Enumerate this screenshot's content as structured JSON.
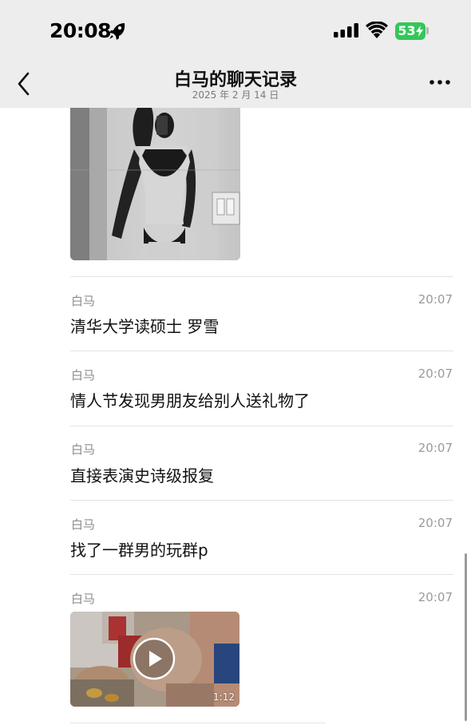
{
  "status_bar": {
    "time": "20:08",
    "battery": "53",
    "icons": [
      "rocket-icon",
      "signal-icon",
      "wifi-icon",
      "battery-icon"
    ],
    "battery_color": "#34c759"
  },
  "header": {
    "title": "白马的聊天记录",
    "subtitle": "2025 年 2 月 14 日",
    "back_icon": "chevron-left-icon",
    "more_icon": "more-dots-icon"
  },
  "messages": [
    {
      "sender": "白马",
      "time": "20:07",
      "text": "清华大学读硕士  罗雪"
    },
    {
      "sender": "白马",
      "time": "20:07",
      "text": "情人节发现男朋友给别人送礼物了"
    },
    {
      "sender": "白马",
      "time": "20:07",
      "text": "直接表演史诗级报复"
    },
    {
      "sender": "白马",
      "time": "20:07",
      "text": "找了一群男的玩群p"
    },
    {
      "sender": "白马",
      "time": "20:07",
      "video": {
        "duration": "1:12"
      }
    }
  ],
  "colors": {
    "header_bg": "#ededed",
    "meta_text": "#8c8c8c",
    "divider": "#e4e4e4"
  }
}
